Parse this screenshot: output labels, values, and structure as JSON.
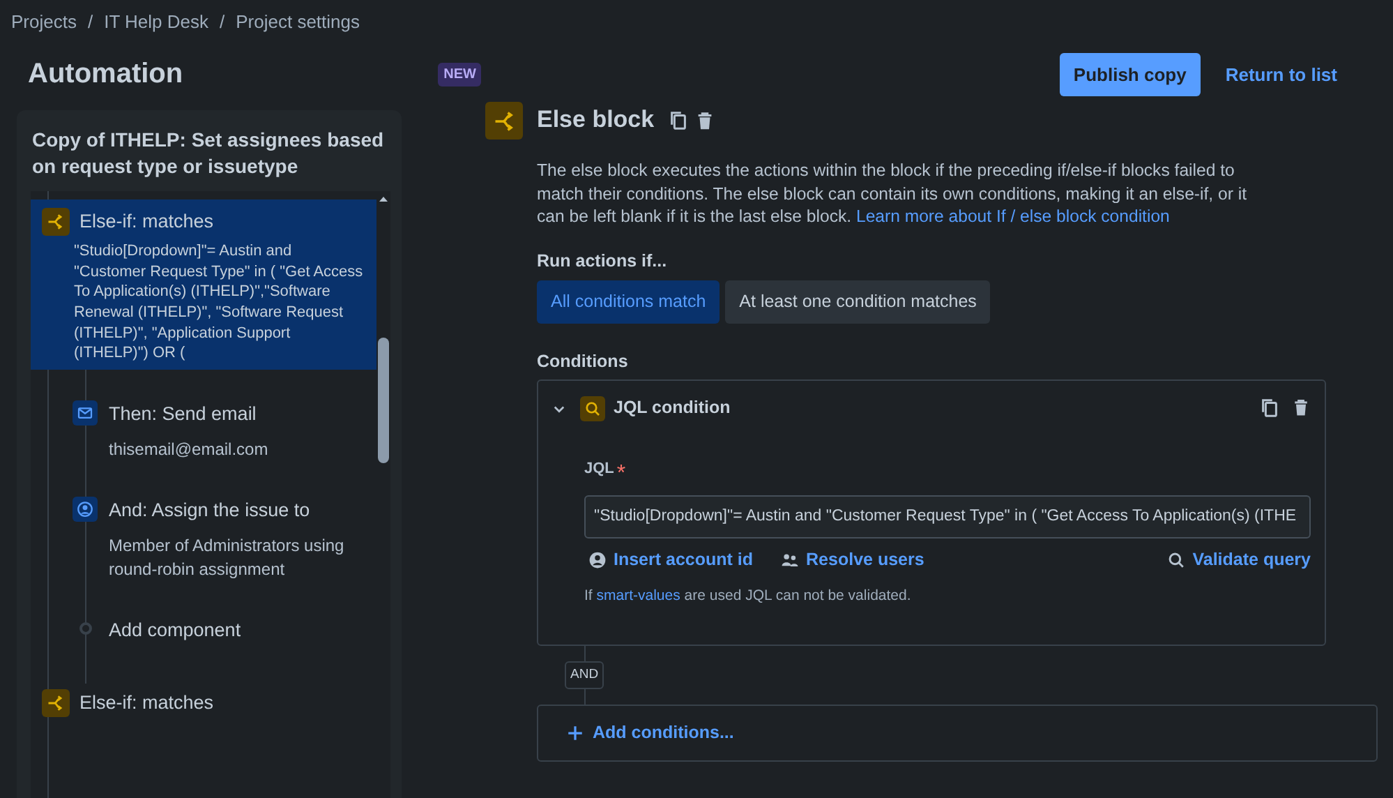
{
  "breadcrumbs": [
    "Projects",
    "IT Help Desk",
    "Project settings"
  ],
  "breadcrumb_separator": "/",
  "header": {
    "title": "Automation",
    "badge": "NEW"
  },
  "actions": {
    "publish": "Publish copy",
    "return": "Return to list"
  },
  "sidebar": {
    "rule_title": "Copy of ITHELP: Set assignees based on request type or issuetype",
    "blocks": [
      {
        "kind": "branch",
        "title": "Else-if: matches",
        "selected": true,
        "detail": "\"Studio[Dropdown]\"= Austin and \"Customer Request Type\" in ( \"Get Access To Application(s) (ITHELP)\",\"Software Renewal (ITHELP)\", \"Software Request (ITHELP)\", \"Application Support (ITHELP)\") OR (",
        "children": [
          {
            "kind": "email",
            "title": "Then: Send email",
            "detail": "thisemail@email.com"
          },
          {
            "kind": "assign",
            "title": "And: Assign the issue to",
            "detail": "Member of Administrators using round-robin assignment"
          },
          {
            "kind": "add",
            "title": "Add component"
          }
        ]
      },
      {
        "kind": "branch",
        "title": "Else-if: matches",
        "selected": false
      }
    ]
  },
  "editor": {
    "title": "Else block",
    "description": "The else block executes the actions within the block if the preceding if/else-if blocks failed to match their conditions. The else block can contain its own conditions, making it an else-if, or it can be left blank if it is the last else block.",
    "description_link": "Learn more about If / else block condition",
    "run_label": "Run actions if...",
    "options": [
      {
        "label": "All conditions match",
        "selected": true
      },
      {
        "label": "At least one condition matches",
        "selected": false
      }
    ],
    "conditions_label": "Conditions",
    "condition": {
      "title": "JQL condition",
      "expanded": true,
      "field_label": "JQL",
      "required_mark": "*",
      "value": "\"Studio[Dropdown]\"= Austin and \"Customer Request Type\" in ( \"Get Access To Application(s) (ITHE",
      "links": [
        {
          "kind": "account",
          "label": "Insert account id"
        },
        {
          "kind": "users",
          "label": "Resolve users"
        },
        {
          "kind": "validate",
          "label": "Validate query"
        }
      ],
      "hint_before": "If ",
      "hint_link": "smart-values",
      "hint_after": " are used JQL can not be validated."
    },
    "joiner": "AND",
    "add_label": "Add conditions..."
  }
}
